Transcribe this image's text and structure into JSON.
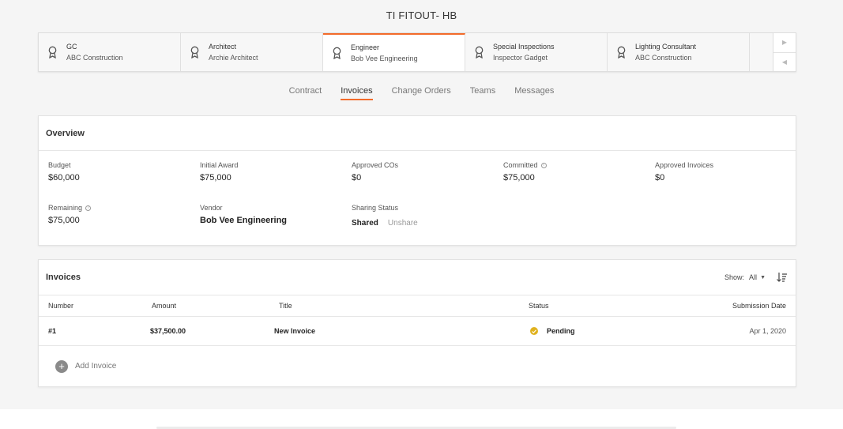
{
  "page_title": "TI FITOUT- HB",
  "roles": [
    {
      "title": "GC",
      "subtitle": "ABC Construction",
      "active": false
    },
    {
      "title": "Architect",
      "subtitle": "Archie Architect",
      "active": false
    },
    {
      "title": "Engineer",
      "subtitle": "Bob Vee Engineering",
      "active": true
    },
    {
      "title": "Special Inspections",
      "subtitle": "Inspector Gadget",
      "active": false
    },
    {
      "title": "Lighting Consultant",
      "subtitle": "ABC Construction",
      "active": false
    }
  ],
  "role_nav": {
    "next_icon": "chevron-right-icon",
    "prev_icon": "chevron-left-icon"
  },
  "tabs": [
    "Contract",
    "Invoices",
    "Change Orders",
    "Teams",
    "Messages"
  ],
  "active_tab": "Invoices",
  "overview": {
    "title": "Overview",
    "budget_label": "Budget",
    "budget_value": "$60,000",
    "initial_award_label": "Initial Award",
    "initial_award_value": "$75,000",
    "approved_cos_label": "Approved COs",
    "approved_cos_value": "$0",
    "committed_label": "Committed",
    "committed_value": "$75,000",
    "approved_invoices_label": "Approved Invoices",
    "approved_invoices_value": "$0",
    "remaining_label": "Remaining",
    "remaining_value": "$75,000",
    "vendor_label": "Vendor",
    "vendor_value": "Bob Vee Engineering",
    "sharing_label": "Sharing Status",
    "shared_label": "Shared",
    "unshare_label": "Unshare"
  },
  "invoices": {
    "title": "Invoices",
    "show_label": "Show:",
    "show_value": "All",
    "columns": [
      "Number",
      "Amount",
      "Title",
      "Status",
      "Submission Date"
    ],
    "rows": [
      {
        "number": "#1",
        "amount": "$37,500.00",
        "title": "New Invoice",
        "status": "Pending",
        "date": "Apr 1, 2020"
      }
    ],
    "add_label": "Add Invoice"
  },
  "colors": {
    "accent": "#f26b2a",
    "pending": "#e0b21f"
  }
}
